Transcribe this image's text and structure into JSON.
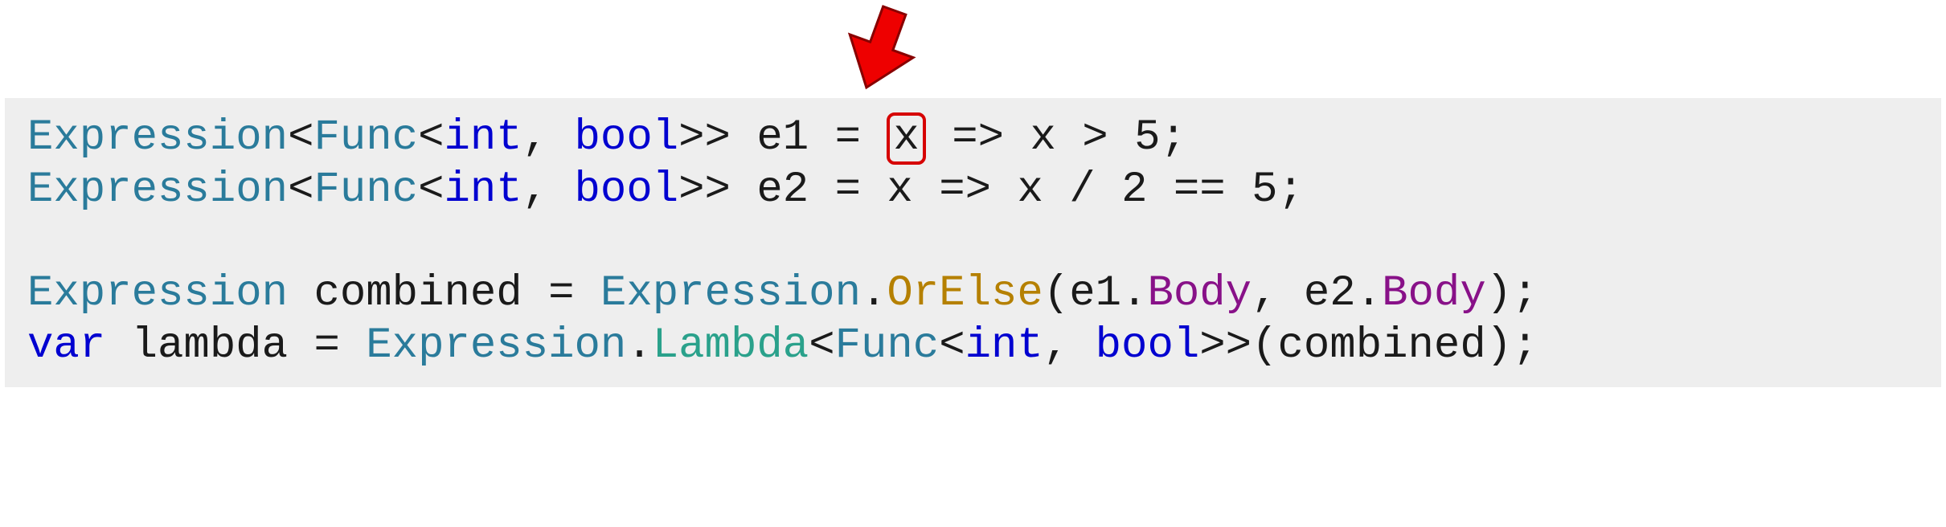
{
  "code": {
    "line1": {
      "type_expr": "Expression",
      "lt1": "<",
      "type_func": "Func",
      "lt2": "<",
      "type_int": "int",
      "comma": ", ",
      "type_bool": "bool",
      "gtgt": ">> ",
      "varname": "e1",
      "eq": " = ",
      "param_x": "x",
      "arrow": " => ",
      "body_x": "x",
      "op": " > ",
      "num": "5",
      "semi": ";"
    },
    "line2": {
      "type_expr": "Expression",
      "lt1": "<",
      "type_func": "Func",
      "lt2": "<",
      "type_int": "int",
      "comma": ", ",
      "type_bool": "bool",
      "gtgt": ">> ",
      "varname": "e2",
      "eq": " = ",
      "param_x": "x",
      "arrow": " => ",
      "body_x": "x",
      "op_div": " / ",
      "num2": "2",
      "op_eq": " == ",
      "num5": "5",
      "semi": ";"
    },
    "line3": {
      "type_expr": "Expression",
      "sp": " ",
      "varname": "combined",
      "eq": " = ",
      "type_expr2": "Expression",
      "dot": ".",
      "method": "OrElse",
      "lparen": "(",
      "e1": "e1",
      "dot1": ".",
      "body1": "Body",
      "comma": ", ",
      "e2": "e2",
      "dot2": ".",
      "body2": "Body",
      "rparen": ")",
      "semi": ";"
    },
    "line4": {
      "var_kw": "var",
      "sp": " ",
      "varname": "lambda",
      "eq": " = ",
      "type_expr": "Expression",
      "dot": ".",
      "method": "Lambda",
      "lt": "<",
      "type_func": "Func",
      "lt2": "<",
      "type_int": "int",
      "comma": ", ",
      "type_bool": "bool",
      "gtgt": ">>",
      "lparen": "(",
      "arg": "combined",
      "rparen": ")",
      "semi": ";"
    }
  },
  "annotation": {
    "arrow_color": "#d60000",
    "highlight_target": "x"
  }
}
